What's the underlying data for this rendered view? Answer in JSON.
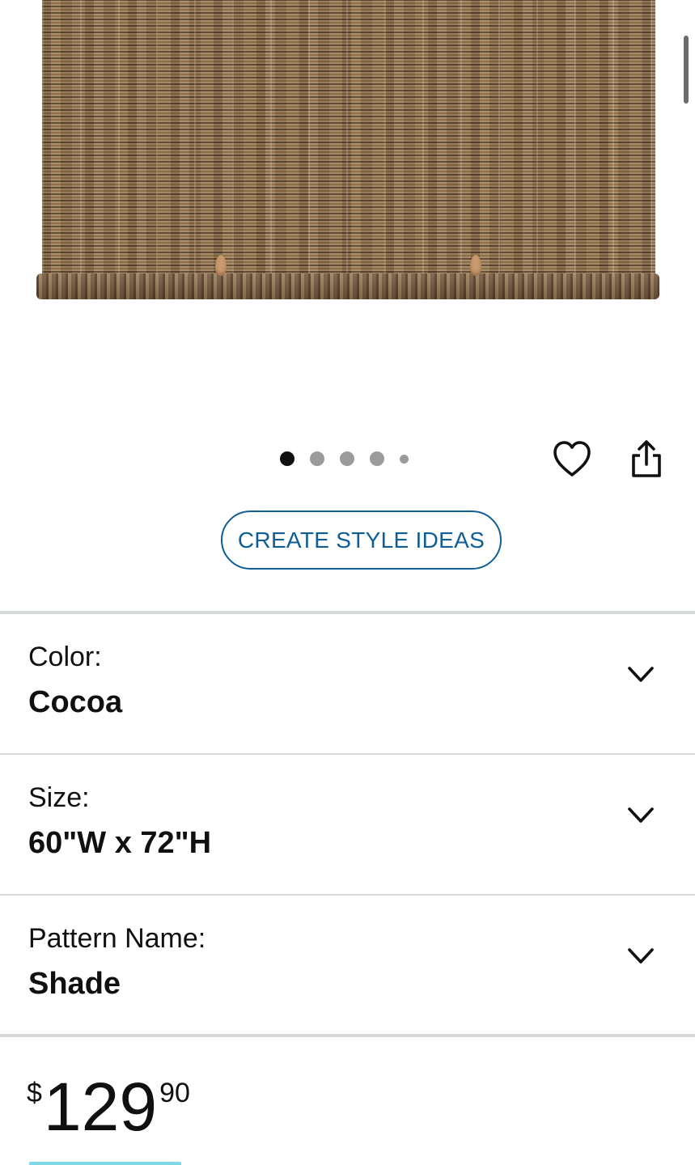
{
  "gallery": {
    "image_count": 5,
    "active_index": 0
  },
  "actions": {
    "wishlist_icon": "heart-outline-icon",
    "share_icon": "share-icon",
    "create_style_ideas_label": "CREATE STYLE IDEAS"
  },
  "variations": [
    {
      "label": "Color:",
      "value": "Cocoa"
    },
    {
      "label": "Size:",
      "value": "60\"W x 72\"H"
    },
    {
      "label": "Pattern Name:",
      "value": "Shade"
    }
  ],
  "price": {
    "symbol": "$",
    "whole": "129",
    "fraction": "90"
  },
  "colors": {
    "link_blue": "#0f5e95",
    "text": "#0f1111",
    "divider": "#d5d9d9"
  }
}
